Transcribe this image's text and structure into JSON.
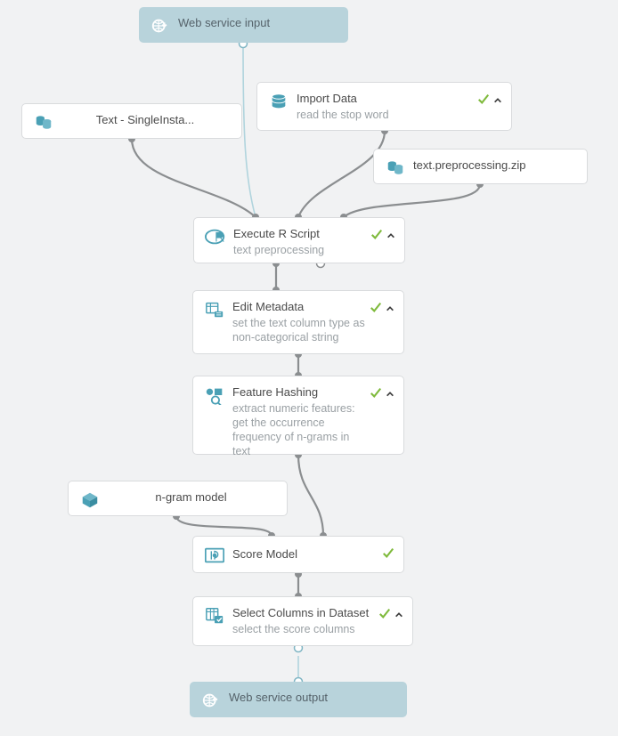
{
  "colors": {
    "bg": "#f1f2f3",
    "node_bg": "#ffffff",
    "node_border": "#d9dbdd",
    "service_bg": "#b8d3db",
    "edge": "#8b8e90",
    "edge_service": "#b0d4dd",
    "icon": "#4aa0b5",
    "title": "#4a4a4a",
    "subtitle": "#9aa0a4",
    "check": "#7fba3c"
  },
  "nodes": {
    "web_input": {
      "title": "Web service input",
      "icon": "globe-in"
    },
    "text_single": {
      "title": "Text - SingleInsta...",
      "icon": "dataset"
    },
    "import_data": {
      "title": "Import Data",
      "subtitle": "read the stop word",
      "icon": "db-cylinder",
      "status": {
        "check": true,
        "chev": true
      }
    },
    "preproc_zip": {
      "title": "text.preprocessing.zip",
      "icon": "dataset"
    },
    "exec_r": {
      "title": "Execute R Script",
      "subtitle": "text preprocessing",
      "icon": "r-script",
      "status": {
        "check": true,
        "chev": true
      }
    },
    "edit_meta": {
      "title": "Edit Metadata",
      "subtitle": "set the text column type as non-categorical string",
      "icon": "edit-meta",
      "status": {
        "check": true,
        "chev": true
      }
    },
    "feat_hash": {
      "title": "Feature Hashing",
      "subtitle": "extract numeric features: get the occurrence frequency of n-grams in text",
      "icon": "feature-hash",
      "status": {
        "check": true,
        "chev": true
      }
    },
    "ngram": {
      "title": "n-gram model",
      "icon": "cube"
    },
    "score": {
      "title": "Score Model",
      "icon": "score-model",
      "status": {
        "check": true,
        "chev": false
      }
    },
    "select_cols": {
      "title": "Select Columns in Dataset",
      "subtitle": "select the score columns",
      "icon": "select-cols",
      "status": {
        "check": true,
        "chev": true
      }
    },
    "web_output": {
      "title": "Web service output",
      "icon": "globe-out"
    }
  }
}
